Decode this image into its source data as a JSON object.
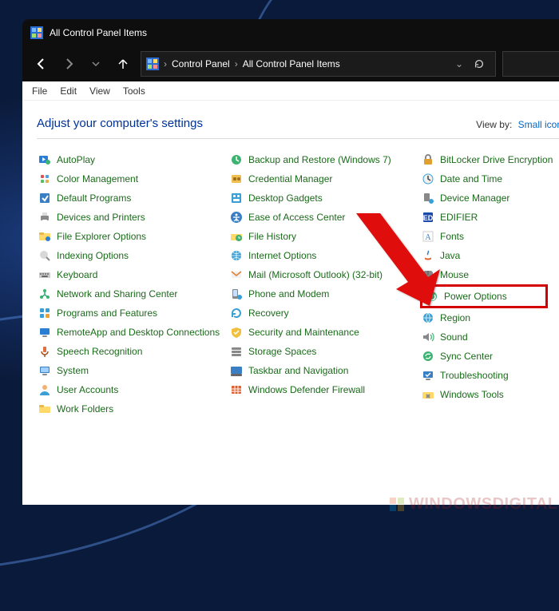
{
  "window": {
    "title": "All Control Panel Items"
  },
  "breadcrumb": {
    "root": "Control Panel",
    "current": "All Control Panel Items"
  },
  "menubar": [
    "File",
    "Edit",
    "View",
    "Tools"
  ],
  "heading": "Adjust your computer's settings",
  "viewby": {
    "label": "View by:",
    "value": "Small icons"
  },
  "highlighted_item": "Power Options",
  "columns": [
    [
      {
        "label": "AutoPlay",
        "icon": "autoplay-icon"
      },
      {
        "label": "Color Management",
        "icon": "color-icon"
      },
      {
        "label": "Default Programs",
        "icon": "programs-icon"
      },
      {
        "label": "Devices and Printers",
        "icon": "printer-icon"
      },
      {
        "label": "File Explorer Options",
        "icon": "folder-options-icon"
      },
      {
        "label": "Indexing Options",
        "icon": "indexing-icon"
      },
      {
        "label": "Keyboard",
        "icon": "keyboard-icon"
      },
      {
        "label": "Network and Sharing Center",
        "icon": "network-icon"
      },
      {
        "label": "Programs and Features",
        "icon": "apps-icon"
      },
      {
        "label": "RemoteApp and Desktop Connections",
        "icon": "remote-icon"
      },
      {
        "label": "Speech Recognition",
        "icon": "mic-icon"
      },
      {
        "label": "System",
        "icon": "system-icon"
      },
      {
        "label": "User Accounts",
        "icon": "user-icon"
      },
      {
        "label": "Work Folders",
        "icon": "folder-icon"
      }
    ],
    [
      {
        "label": "Backup and Restore (Windows 7)",
        "icon": "backup-icon"
      },
      {
        "label": "Credential Manager",
        "icon": "credential-icon"
      },
      {
        "label": "Desktop Gadgets",
        "icon": "gadgets-icon"
      },
      {
        "label": "Ease of Access Center",
        "icon": "ease-access-icon"
      },
      {
        "label": "File History",
        "icon": "history-icon"
      },
      {
        "label": "Internet Options",
        "icon": "globe-icon"
      },
      {
        "label": "Mail (Microsoft Outlook) (32-bit)",
        "icon": "mail-icon"
      },
      {
        "label": "Phone and Modem",
        "icon": "phone-icon"
      },
      {
        "label": "Recovery",
        "icon": "recovery-icon"
      },
      {
        "label": "Security and Maintenance",
        "icon": "security-icon"
      },
      {
        "label": "Storage Spaces",
        "icon": "storage-icon"
      },
      {
        "label": "Taskbar and Navigation",
        "icon": "taskbar-icon"
      },
      {
        "label": "Windows Defender Firewall",
        "icon": "firewall-icon"
      }
    ],
    [
      {
        "label": "BitLocker Drive Encryption",
        "icon": "bitlocker-icon"
      },
      {
        "label": "Date and Time",
        "icon": "clock-icon"
      },
      {
        "label": "Device Manager",
        "icon": "device-icon"
      },
      {
        "label": "EDIFIER",
        "icon": "edifier-icon"
      },
      {
        "label": "Fonts",
        "icon": "fonts-icon"
      },
      {
        "label": "Java",
        "icon": "java-icon"
      },
      {
        "label": "Mouse",
        "icon": "mouse-icon"
      },
      {
        "label": "Power Options",
        "icon": "power-icon"
      },
      {
        "label": "Region",
        "icon": "region-icon"
      },
      {
        "label": "Sound",
        "icon": "sound-icon"
      },
      {
        "label": "Sync Center",
        "icon": "sync-icon"
      },
      {
        "label": "Troubleshooting",
        "icon": "troubleshoot-icon"
      },
      {
        "label": "Windows Tools",
        "icon": "tools-icon"
      }
    ]
  ],
  "watermark": "WINDOWSDIGITALS.COM"
}
